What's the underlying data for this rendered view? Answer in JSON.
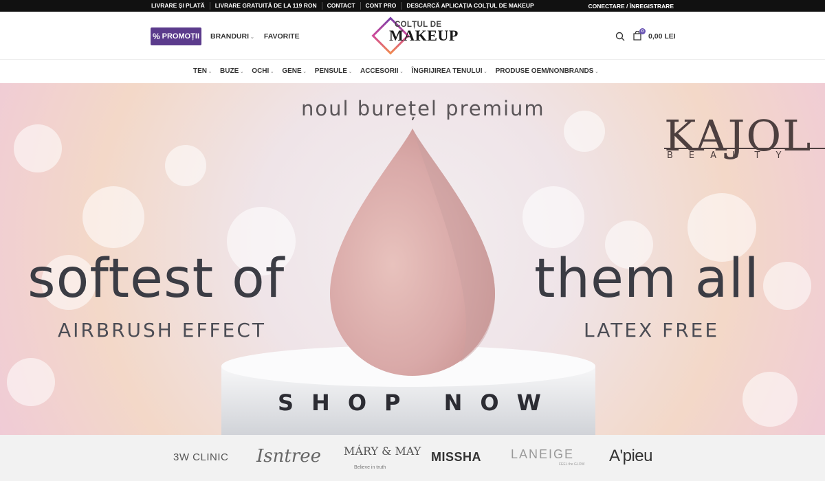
{
  "topbar": {
    "links": [
      "LIVRARE ȘI PLATĂ",
      "LIVRARE GRATUITĂ DE LA 119 RON",
      "CONTACT",
      "CONT PRO",
      "DESCARCĂ APLICAȚIA COLȚUL DE MAKEUP"
    ],
    "account": "CONECTARE / ÎNREGISTRARE"
  },
  "header": {
    "promo_label": "PROMOȚII",
    "promo_icon": "percent-icon",
    "nav": [
      "BRANDURI",
      "FAVORITE"
    ],
    "logo_line1": "COLȚUL DE",
    "logo_line2": "MAKEUP",
    "cart_count": "0",
    "cart_total": "0,00 LEI",
    "brand_color": "#5b3b8c"
  },
  "categories": [
    "TEN",
    "BUZE",
    "OCHI",
    "GENE",
    "PENSULE",
    "ACCESORII",
    "ÎNGRIJIREA TENULUI",
    "PRODUSE OEM/NONBRANDS"
  ],
  "search": {
    "placeholder": "Caută"
  },
  "hero": {
    "tagline": "noul burețel premium",
    "headline_left": "softest of",
    "headline_right": "them all",
    "sub_left": "AIRBRUSH EFFECT",
    "sub_right": "LATEX FREE",
    "brand": "KAJOL",
    "brand_sub": "BEAUTY",
    "cta": "SHOP NOW"
  },
  "brands": {
    "items": [
      "3W CLINIC",
      "Isntree",
      "MÁRY & MAY",
      "MISSHA",
      "LANEIGE",
      "A'pieu"
    ],
    "mary_may_sub": "Believe in truth",
    "laneige_sub": "FEEL the GLOW"
  }
}
